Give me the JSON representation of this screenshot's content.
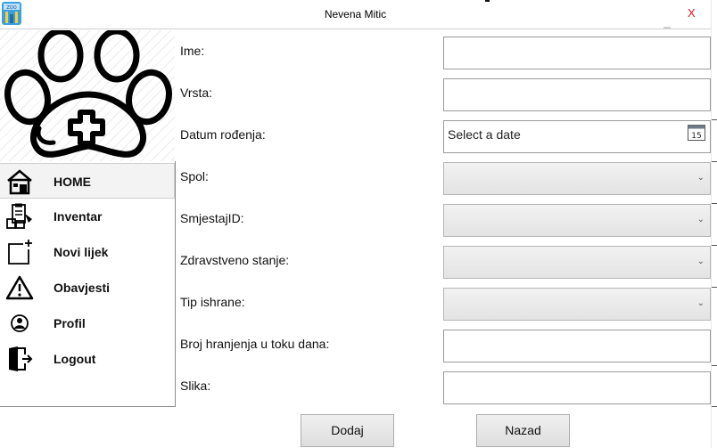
{
  "window": {
    "title": "Nevena Mitic",
    "close_label": "X"
  },
  "sidebar": {
    "items": [
      {
        "label": "HOME",
        "icon": "house-icon",
        "active": true
      },
      {
        "label": "Inventar",
        "icon": "inventory-icon",
        "active": false
      },
      {
        "label": "Novi lijek",
        "icon": "new-item-icon",
        "active": false
      },
      {
        "label": "Obavjesti",
        "icon": "warning-icon",
        "active": false
      },
      {
        "label": "Profil",
        "icon": "user-icon",
        "active": false
      },
      {
        "label": "Logout",
        "icon": "logout-door-icon",
        "active": false
      }
    ]
  },
  "form": {
    "ime": {
      "label": "Ime:",
      "value": ""
    },
    "vrsta": {
      "label": "Vrsta:",
      "value": ""
    },
    "datum": {
      "label": "Datum rođenja:",
      "placeholder": "Select a date",
      "value": ""
    },
    "spol": {
      "label": "Spol:",
      "selected": ""
    },
    "smjestaj": {
      "label": "SmjestajID:",
      "selected": ""
    },
    "zdravstveno": {
      "label": "Zdravstveno stanje:",
      "selected": ""
    },
    "ishrana": {
      "label": "Tip ishrane:",
      "selected": ""
    },
    "hranjenja": {
      "label": "Broj hranjenja u toku dana:",
      "value": ""
    },
    "slika": {
      "label": "Slika:",
      "value": ""
    }
  },
  "buttons": {
    "add_label": "Dodaj",
    "back_label": "Nazad"
  },
  "calendar_day": "15",
  "colors": {
    "close": "#e81123",
    "active_item_bg": "#f3f3f3",
    "combo_bg": "#e8e8e8"
  }
}
